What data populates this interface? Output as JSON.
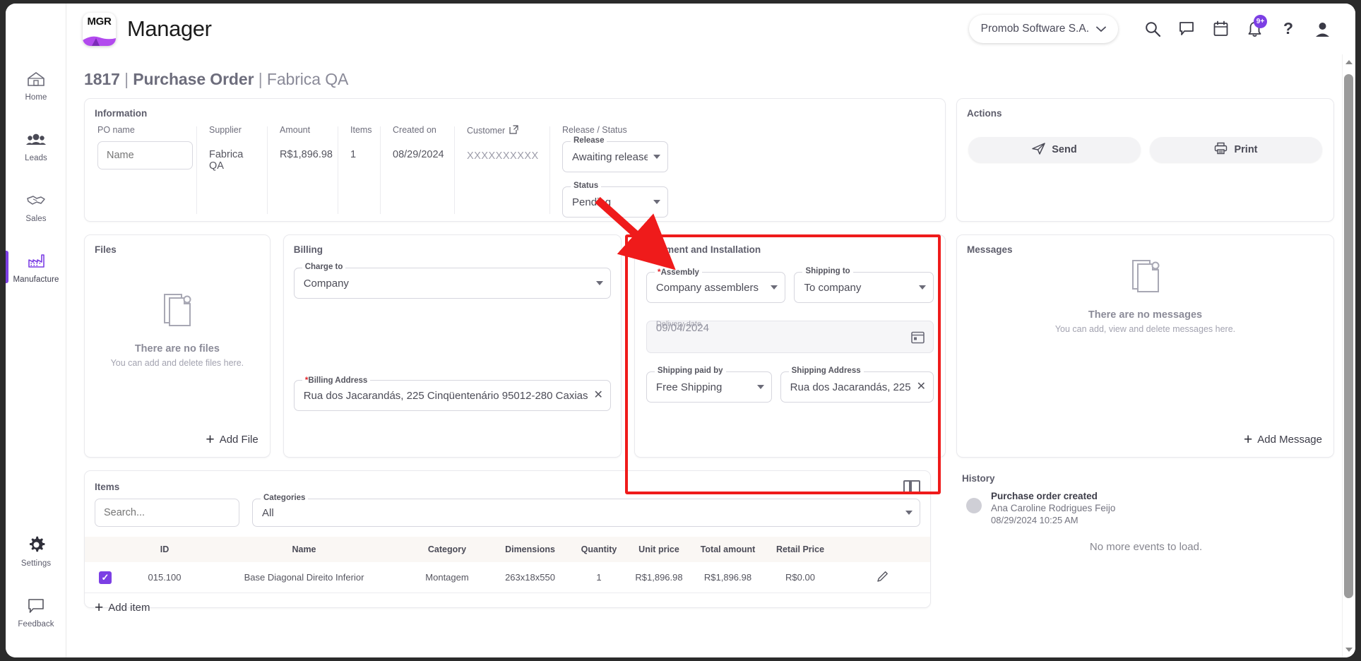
{
  "app": {
    "logo_text": "MGR",
    "title": "Manager"
  },
  "topbar": {
    "org": "Promob Software S.A.",
    "icons": {
      "search": "search-icon",
      "chat": "chat-icon",
      "calendar": "calendar-icon",
      "notifications": "bell-icon",
      "help": "help-icon",
      "profile": "user-icon"
    },
    "notification_badge": "9+"
  },
  "sidebar": {
    "top_items": [
      {
        "label": "Home",
        "icon": "home-icon",
        "active": false
      },
      {
        "label": "Leads",
        "icon": "people-icon",
        "active": false
      },
      {
        "label": "Sales",
        "icon": "handshake-icon",
        "active": false
      },
      {
        "label": "Manufacture",
        "icon": "factory-icon",
        "active": true
      }
    ],
    "bottom_items": [
      {
        "label": "Settings",
        "icon": "gear-icon"
      },
      {
        "label": "Feedback",
        "icon": "speech-bubble-icon"
      }
    ]
  },
  "page": {
    "title_id": "1817",
    "title_type": "Purchase Order",
    "title_vendor": "Fabrica QA",
    "sep": " | "
  },
  "information": {
    "heading": "Information",
    "po_name_label": "PO name",
    "po_name_placeholder": "Name",
    "po_name_value": "",
    "fields": [
      {
        "label": "Supplier",
        "value": "Fabrica QA"
      },
      {
        "label": "Amount",
        "value": "R$1,896.98"
      },
      {
        "label": "Items",
        "value": "1"
      },
      {
        "label": "Created on",
        "value": "08/29/2024"
      }
    ],
    "customer_label": "Customer",
    "customer_value": "XXXXXXXXXX",
    "release_group_label": "Release / Status",
    "release_label": "Release",
    "release_value": "Awaiting release",
    "status_label": "Status",
    "status_value": "Pending"
  },
  "files": {
    "heading": "Files",
    "empty_title": "There are no files",
    "empty_sub": "You can add and delete files here.",
    "add_label": "Add File"
  },
  "billing": {
    "heading": "Billing",
    "charge_to_label": "Charge to",
    "charge_to_value": "Company",
    "billing_address_label": "Billing Address",
    "billing_address_required": "*",
    "billing_address_value": "Rua dos Jacarandás, 225 Cinqüentenário 95012-280 Caxias "
  },
  "shipment": {
    "heading": "Shipment and Installation",
    "assembly_label": "Assembly",
    "assembly_required": "*",
    "assembly_value": "Company assemblers",
    "shipping_to_label": "Shipping to",
    "shipping_to_value": "To company",
    "delivery_date_label": "Delivery date",
    "delivery_date_value": "09/04/2024",
    "shipping_paid_by_label": "Shipping paid by",
    "shipping_paid_by_value": "Free Shipping",
    "shipping_address_label": "Shipping Address",
    "shipping_address_value": "Rua dos Jacarandás, 225"
  },
  "actions": {
    "heading": "Actions",
    "send_label": "Send",
    "print_label": "Print"
  },
  "messages": {
    "heading": "Messages",
    "empty_title": "There are no messages",
    "empty_sub": "You can add, view and delete messages here.",
    "add_label": "Add Message"
  },
  "history": {
    "heading": "History",
    "event_title": "Purchase order created",
    "event_user": "Ana Caroline Rodrigues Feijo",
    "event_time": "08/29/2024 10:25 AM",
    "end_text": "No more events to load."
  },
  "items": {
    "heading": "Items",
    "search_placeholder": "Search...",
    "categories_label": "Categories",
    "categories_value": "All",
    "columns": [
      "ID",
      "Name",
      "Category",
      "Dimensions",
      "Quantity",
      "Unit price",
      "Total amount",
      "Retail Price"
    ],
    "rows": [
      {
        "checked": true,
        "id": "015.100",
        "name": "Base Diagonal Direito Inferior",
        "category": "Montagem",
        "dimensions": "263x18x550",
        "quantity": "1",
        "unit_price": "R$1,896.98",
        "total_amount": "R$1,896.98",
        "retail_price": "R$0.00"
      }
    ],
    "add_label": "Add item"
  },
  "annotation": {
    "color": "#ef1b1b",
    "target": "Shipment and Installation panel"
  },
  "colors": {
    "accent": "#7c3fe4",
    "annotation": "#ef1b1b",
    "table_header_bg": "#faf7f4"
  }
}
